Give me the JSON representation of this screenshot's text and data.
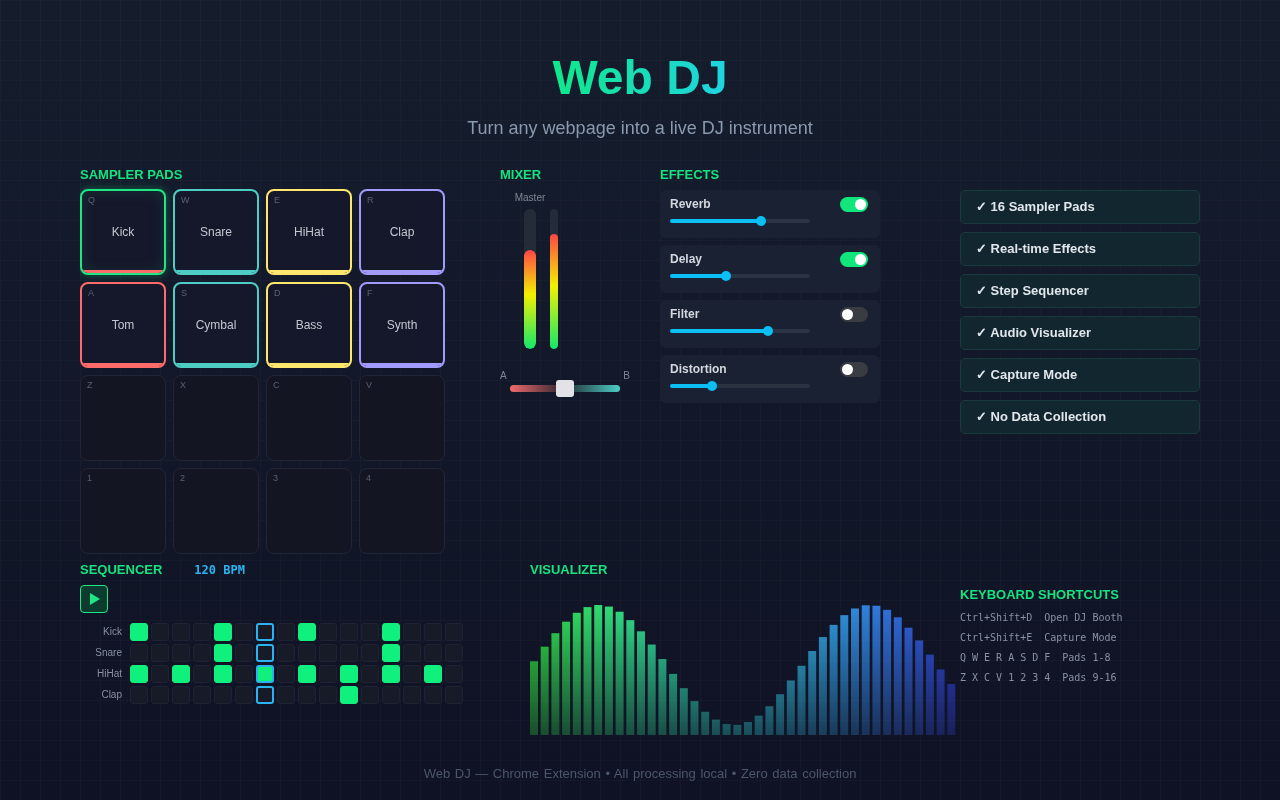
{
  "header": {
    "title": "Web DJ",
    "subtitle": "Turn any webpage into a live DJ instrument"
  },
  "sampler": {
    "title": "SAMPLER PADS",
    "pads": [
      {
        "kind": "sample",
        "key": "Q",
        "name": "Kick",
        "color": "#ff6b6b",
        "active": true
      },
      {
        "kind": "sample",
        "key": "W",
        "name": "Snare",
        "color": "#4ecdc4",
        "active": false
      },
      {
        "kind": "sample",
        "key": "E",
        "name": "HiHat",
        "color": "#ffe66d",
        "active": false
      },
      {
        "kind": "sample",
        "key": "R",
        "name": "Clap",
        "color": "#a29bfe",
        "active": false
      },
      {
        "kind": "sample",
        "key": "A",
        "name": "Tom",
        "color": "#ff6b6b",
        "active": false
      },
      {
        "kind": "sample",
        "key": "S",
        "name": "Cymbal",
        "color": "#4ecdc4",
        "active": false
      },
      {
        "kind": "sample",
        "key": "D",
        "name": "Bass",
        "color": "#ffe66d",
        "active": false
      },
      {
        "kind": "sample",
        "key": "F",
        "name": "Synth",
        "color": "#a29bfe",
        "active": false
      },
      {
        "kind": "empty",
        "key": "Z",
        "active": false
      },
      {
        "kind": "empty",
        "key": "X",
        "active": false
      },
      {
        "kind": "empty",
        "key": "C",
        "active": false
      },
      {
        "kind": "empty",
        "key": "V",
        "active": false
      },
      {
        "kind": "empty",
        "key": "1",
        "active": false
      },
      {
        "kind": "empty",
        "key": "2",
        "active": false
      },
      {
        "kind": "empty",
        "key": "3",
        "active": false
      },
      {
        "kind": "empty",
        "key": "4",
        "active": false
      }
    ]
  },
  "mixer": {
    "title": "MIXER",
    "master_label": "Master",
    "meters": [
      {
        "level": 0.71
      },
      {
        "level": 0.82
      }
    ],
    "crossfader": {
      "label_a": "A",
      "label_b": "B",
      "level": 0.5
    }
  },
  "effects": {
    "title": "EFFECTS",
    "items": [
      {
        "name": "Reverb",
        "enabled": true,
        "level": 0.65
      },
      {
        "name": "Delay",
        "enabled": true,
        "level": 0.4
      },
      {
        "name": "Filter",
        "enabled": false,
        "level": 0.7
      },
      {
        "name": "Distortion",
        "enabled": false,
        "level": 0.3
      }
    ]
  },
  "features": [
    "✓ 16 Sampler Pads",
    "✓ Real-time Effects",
    "✓ Step Sequencer",
    "✓ Audio Visualizer",
    "✓ Capture Mode",
    "✓ No Data Collection"
  ],
  "sequencer": {
    "title": "SEQUENCER",
    "bpm": "120 BPM",
    "rows": [
      {
        "name": "Kick",
        "steps": [
          {
            "on": true,
            "current": false
          },
          {
            "on": false,
            "current": false
          },
          {
            "on": false,
            "current": false
          },
          {
            "on": false,
            "current": false
          },
          {
            "on": true,
            "current": false
          },
          {
            "on": false,
            "current": false
          },
          {
            "on": false,
            "current": true
          },
          {
            "on": false,
            "current": false
          },
          {
            "on": true,
            "current": false
          },
          {
            "on": false,
            "current": false
          },
          {
            "on": false,
            "current": false
          },
          {
            "on": false,
            "current": false
          },
          {
            "on": true,
            "current": false
          },
          {
            "on": false,
            "current": false
          },
          {
            "on": false,
            "current": false
          },
          {
            "on": false,
            "current": false
          }
        ]
      },
      {
        "name": "Snare",
        "steps": [
          {
            "on": false,
            "current": false
          },
          {
            "on": false,
            "current": false
          },
          {
            "on": false,
            "current": false
          },
          {
            "on": false,
            "current": false
          },
          {
            "on": true,
            "current": false
          },
          {
            "on": false,
            "current": false
          },
          {
            "on": false,
            "current": true
          },
          {
            "on": false,
            "current": false
          },
          {
            "on": false,
            "current": false
          },
          {
            "on": false,
            "current": false
          },
          {
            "on": false,
            "current": false
          },
          {
            "on": false,
            "current": false
          },
          {
            "on": true,
            "current": false
          },
          {
            "on": false,
            "current": false
          },
          {
            "on": false,
            "current": false
          },
          {
            "on": false,
            "current": false
          }
        ]
      },
      {
        "name": "HiHat",
        "steps": [
          {
            "on": true,
            "current": false
          },
          {
            "on": false,
            "current": false
          },
          {
            "on": true,
            "current": false
          },
          {
            "on": false,
            "current": false
          },
          {
            "on": true,
            "current": false
          },
          {
            "on": false,
            "current": false
          },
          {
            "on": true,
            "current": true
          },
          {
            "on": false,
            "current": false
          },
          {
            "on": true,
            "current": false
          },
          {
            "on": false,
            "current": false
          },
          {
            "on": true,
            "current": false
          },
          {
            "on": false,
            "current": false
          },
          {
            "on": true,
            "current": false
          },
          {
            "on": false,
            "current": false
          },
          {
            "on": true,
            "current": false
          },
          {
            "on": false,
            "current": false
          }
        ]
      },
      {
        "name": "Clap",
        "steps": [
          {
            "on": false,
            "current": false
          },
          {
            "on": false,
            "current": false
          },
          {
            "on": false,
            "current": false
          },
          {
            "on": false,
            "current": false
          },
          {
            "on": false,
            "current": false
          },
          {
            "on": false,
            "current": false
          },
          {
            "on": false,
            "current": true
          },
          {
            "on": false,
            "current": false
          },
          {
            "on": false,
            "current": false
          },
          {
            "on": false,
            "current": false
          },
          {
            "on": true,
            "current": false
          },
          {
            "on": false,
            "current": false
          },
          {
            "on": false,
            "current": false
          },
          {
            "on": false,
            "current": false
          },
          {
            "on": false,
            "current": false
          },
          {
            "on": false,
            "current": false
          }
        ]
      }
    ]
  },
  "visualizer": {
    "title": "VISUALIZER"
  },
  "shortcuts": {
    "title": "KEYBOARD SHORTCUTS",
    "items": [
      {
        "keys": "Ctrl+Shift+D",
        "action": "Open DJ Booth"
      },
      {
        "keys": "Ctrl+Shift+E",
        "action": "Capture Mode"
      },
      {
        "keys": "Q W E R A S D F",
        "action": "Pads 1-8"
      },
      {
        "keys": "Z X C V 1 2 3 4",
        "action": "Pads 9-16"
      }
    ]
  },
  "footer": "Web DJ — Chrome Extension • All processing local • Zero data collection"
}
